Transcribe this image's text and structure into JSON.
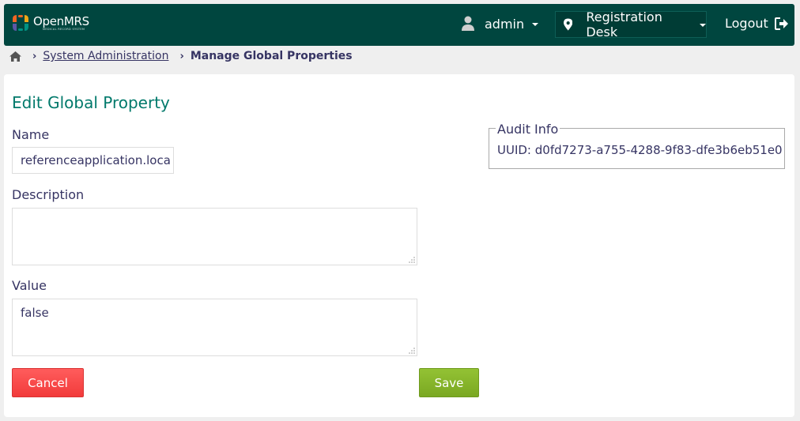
{
  "header": {
    "logo_name": "OpenMRS",
    "logo_subtitle": "MEDICAL RECORD SYSTEM",
    "user_label": "admin",
    "location_label": "Registration Desk",
    "logout_label": "Logout",
    "icons": {
      "user": "user-icon",
      "location": "map-pin-icon",
      "logout": "sign-out-icon",
      "home": "home-icon"
    },
    "colors": {
      "background": "#00463f",
      "accent": "#00796b"
    }
  },
  "breadcrumb": {
    "separator": "›",
    "items": [
      "System Administration"
    ],
    "current": "Manage Global Properties"
  },
  "form": {
    "title": "Edit Global Property",
    "name_label": "Name",
    "name_value": "referenceapplication.loca",
    "description_label": "Description",
    "description_value": "",
    "value_label": "Value",
    "value_value": "false",
    "audit_legend": "Audit Info",
    "audit_uuid": "UUID: d0fd7273-a755-4288-9f83-dfe3b6eb51e0",
    "cancel_label": "Cancel",
    "save_label": "Save",
    "colors": {
      "cancel": "#f23b3b",
      "save": "#88b52c"
    }
  }
}
